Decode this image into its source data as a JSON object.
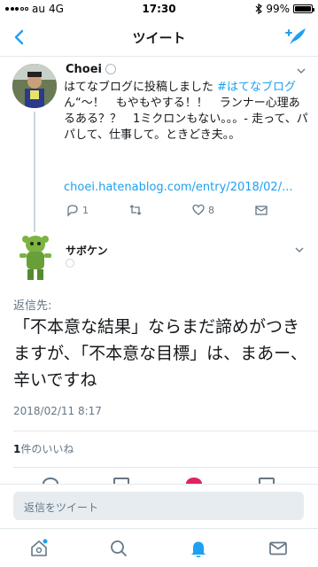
{
  "status_bar": {
    "carrier": "au",
    "network": "4G",
    "time": "17:30",
    "battery": "99%",
    "battery_level": 0.99
  },
  "nav": {
    "title": "ツイート",
    "icons": [
      "chevron-left-icon",
      "compose-tweet-icon"
    ]
  },
  "parent_tweet": {
    "name": "Choei",
    "text_prefix": "はてなブログに投稿しました ",
    "hashtag": "#はてなブログ",
    "text_body": "ん“〜！　もやもやする！！　ランナー心理あるある？？　1ミクロンもない。。。- 走って、パパして、仕事して。ときどき夫。。",
    "link": "choei.hatenablog.com/entry/2018/02/...",
    "reply_count": "1",
    "retweet_count": "",
    "like_count": "8"
  },
  "main_tweet": {
    "name": "サボケン",
    "reply_label": "返信先:",
    "text": "「不本意な結果」ならまだ諦めがつきますが、「不本意な目標」は、まあー、辛いですね",
    "timestamp": "2018/02/11 8:17",
    "likes_number": "1",
    "likes_suffix": "件のいいね"
  },
  "reply_box": {
    "placeholder": "返信をツイート"
  },
  "tab_bar": {
    "items": [
      "home-icon",
      "search-icon",
      "notifications-icon",
      "messages-icon"
    ],
    "active": "notifications-icon"
  },
  "colors": {
    "accent": "#1da1f2",
    "secondary_text": "#657786",
    "divider": "#e1e8ed",
    "like_red": "#e0245e"
  }
}
